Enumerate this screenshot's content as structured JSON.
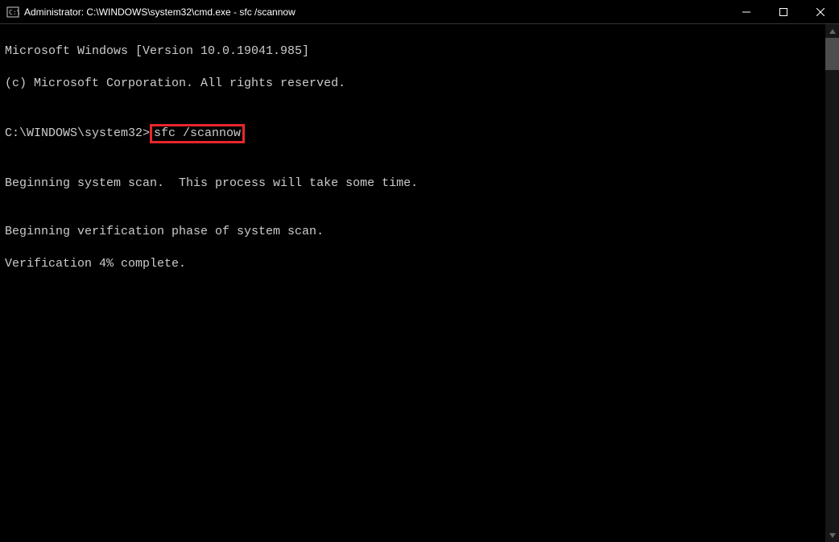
{
  "titlebar": {
    "title": "Administrator: C:\\WINDOWS\\system32\\cmd.exe - sfc  /scannow"
  },
  "terminal": {
    "line1": "Microsoft Windows [Version 10.0.19041.985]",
    "line2": "(c) Microsoft Corporation. All rights reserved.",
    "blank1": "",
    "prompt_path": "C:\\WINDOWS\\system32>",
    "command": "sfc /scannow",
    "blank2": "",
    "scan_begin": "Beginning system scan.  This process will take some time.",
    "blank3": "",
    "verify_begin": "Beginning verification phase of system scan.",
    "verify_progress": "Verification 4% complete."
  }
}
